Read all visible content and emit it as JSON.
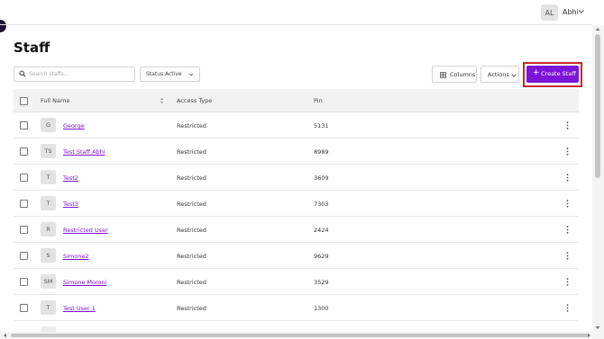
{
  "header": {
    "avatar_initials": "AL",
    "user_name": "Abhi"
  },
  "page": {
    "title": "Staff"
  },
  "toolbar": {
    "search_placeholder": "Search staffs...",
    "status_label": "Status:",
    "status_value": "Active",
    "columns_label": "Columns",
    "actions_label": "Actions",
    "create_label": "Create Staff"
  },
  "table": {
    "columns": {
      "name": "Full Name",
      "access": "Access Type",
      "pin": "Pin"
    },
    "rows": [
      {
        "initials": "G",
        "name": "George",
        "access": "Restricted",
        "pin": "5131"
      },
      {
        "initials": "TS",
        "name": "Test Staff Abhi",
        "access": "Restricted",
        "pin": "8989"
      },
      {
        "initials": "T",
        "name": "Test2",
        "access": "Restricted",
        "pin": "3609"
      },
      {
        "initials": "T",
        "name": "Test3",
        "access": "Restricted",
        "pin": "7303"
      },
      {
        "initials": "R",
        "name": "Restricted User",
        "access": "Restricted",
        "pin": "2424"
      },
      {
        "initials": "S",
        "name": "Simone2",
        "access": "Restricted",
        "pin": "9629"
      },
      {
        "initials": "SM",
        "name": "Simone Moroni",
        "access": "Restricted",
        "pin": "3529"
      },
      {
        "initials": "T",
        "name": "Test User 1",
        "access": "Restricted",
        "pin": "1300"
      }
    ]
  },
  "colors": {
    "accent": "#7c14d6",
    "highlight": "#c62828"
  },
  "icons": [
    "search-icon",
    "chevron-down-icon",
    "columns-icon",
    "plus-icon",
    "sort-icon",
    "kebab-menu-icon"
  ]
}
